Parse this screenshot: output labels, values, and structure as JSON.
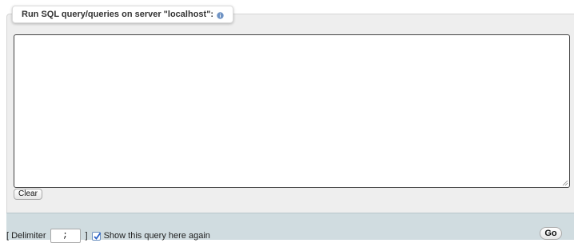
{
  "query_box": {
    "legend": "Run SQL query/queries on server \"localhost\":",
    "help_icon": "info-icon",
    "query_text": "",
    "clear_label": "Clear"
  },
  "footer": {
    "delimiter_open": "[ Delimiter",
    "delimiter_value": ";",
    "delimiter_close": "]",
    "show_query_checked": true,
    "show_query_label": "Show this query here again",
    "go_label": "Go"
  },
  "colors": {
    "panel_bg": "#eeeeee",
    "footer_bg": "#d0dce0",
    "checkbox_accent": "#2a62c8",
    "help_icon": "#6f93c4"
  }
}
